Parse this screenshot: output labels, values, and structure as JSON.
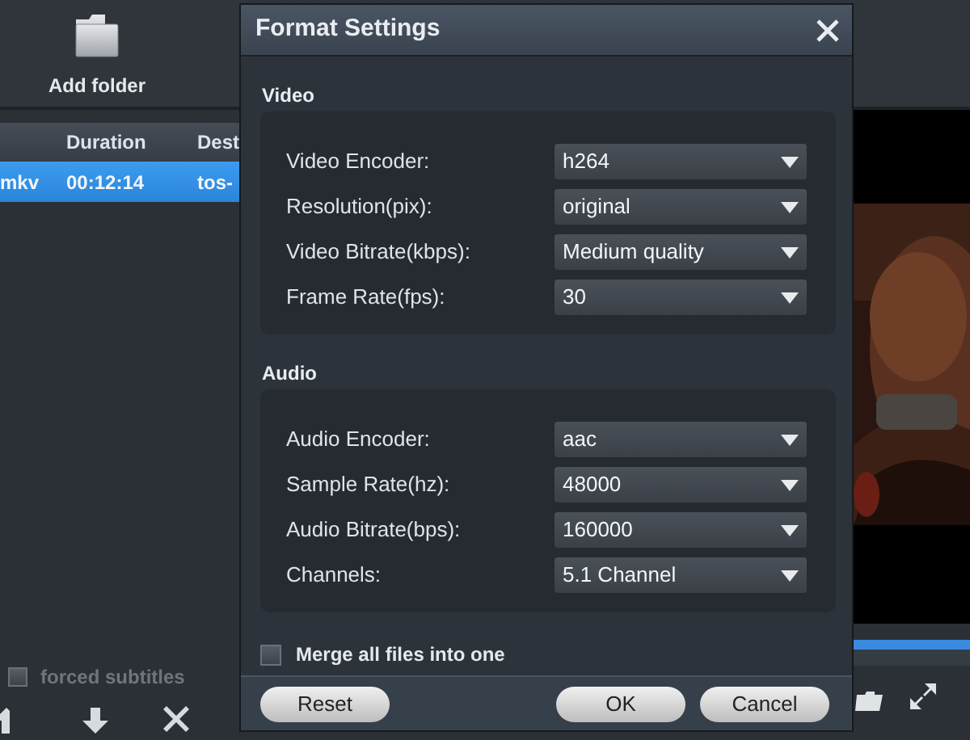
{
  "toolbar": {
    "add_folder": "Add folder"
  },
  "table": {
    "columns": [
      "",
      "Duration",
      "Dest"
    ],
    "rows": [
      {
        "cells": [
          "mkv",
          "00:12:14",
          "tos-"
        ],
        "selected": true
      }
    ]
  },
  "forced_subtitles": {
    "label": "forced subtitles",
    "checked": false
  },
  "dialog": {
    "title": "Format Settings",
    "sections": [
      {
        "title": "Video",
        "fields": [
          {
            "label": "Video Encoder:",
            "value": "h264"
          },
          {
            "label": "Resolution(pix):",
            "value": "original"
          },
          {
            "label": "Video Bitrate(kbps):",
            "value": "Medium quality"
          },
          {
            "label": "Frame Rate(fps):",
            "value": "30"
          }
        ]
      },
      {
        "title": "Audio",
        "fields": [
          {
            "label": "Audio Encoder:",
            "value": "aac"
          },
          {
            "label": "Sample Rate(hz):",
            "value": "48000"
          },
          {
            "label": "Audio Bitrate(bps):",
            "value": "160000"
          },
          {
            "label": "Channels:",
            "value": "5.1 Channel"
          }
        ]
      }
    ],
    "merge": {
      "label": "Merge all files into one",
      "checked": false
    },
    "buttons": [
      {
        "label": "Reset",
        "kind": "left"
      },
      {
        "label": "OK",
        "kind": "right"
      },
      {
        "label": "Cancel",
        "kind": "right"
      }
    ]
  }
}
